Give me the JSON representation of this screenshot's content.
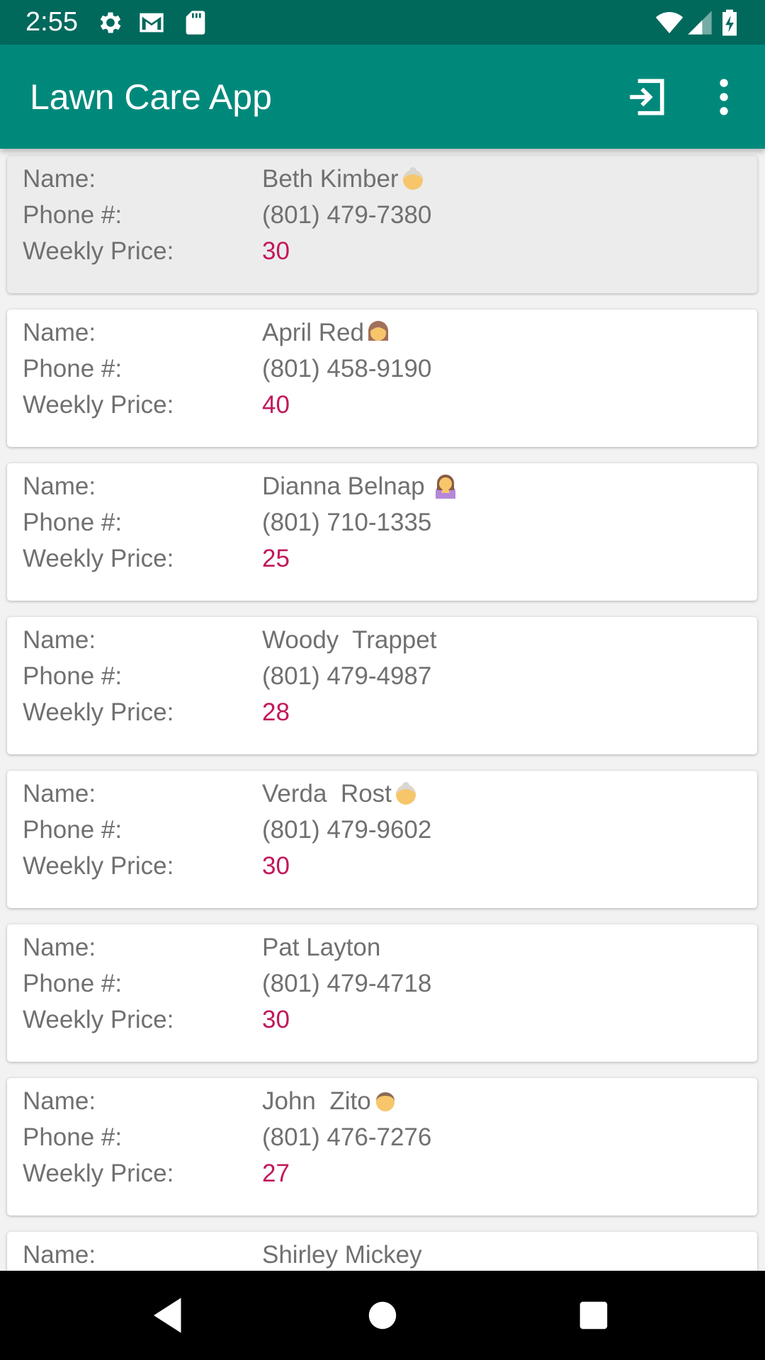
{
  "status_bar": {
    "time": "2:55",
    "left_icons": [
      "gear-icon",
      "gmail-icon",
      "sd-card-icon"
    ],
    "right_icons": [
      "wifi-icon",
      "cell-signal-icon",
      "battery-charging-icon"
    ]
  },
  "app_bar": {
    "title": "Lawn Care App",
    "actions": [
      "logout-icon",
      "more-vert-icon"
    ]
  },
  "labels": {
    "name": "Name:",
    "phone": "Phone #:",
    "price": "Weekly Price:"
  },
  "customers": [
    {
      "name": "Beth Kimber",
      "emoji": "older-woman",
      "phone": "(801) 479-7380",
      "price": "30",
      "selected": true
    },
    {
      "name": "April Red",
      "emoji": "woman",
      "phone": "(801) 458-9190",
      "price": "40"
    },
    {
      "name": "Dianna Belnap ",
      "emoji": "woman-facepalm",
      "phone": "(801) 710-1335",
      "price": "25"
    },
    {
      "name": "Woody  Trappet",
      "emoji": "",
      "phone": "(801) 479-4987",
      "price": "28"
    },
    {
      "name": "Verda  Rost",
      "emoji": "older-woman",
      "phone": "(801) 479-9602",
      "price": "30"
    },
    {
      "name": "Pat Layton",
      "emoji": "",
      "phone": "(801) 479-4718",
      "price": "30"
    },
    {
      "name": "John  Zito",
      "emoji": "man",
      "phone": "(801) 476-7276",
      "price": "27"
    },
    {
      "name": "Shirley Mickey",
      "emoji": "",
      "phone": "",
      "price": ""
    }
  ],
  "nav_bar": {
    "buttons": [
      "back-icon",
      "home-icon",
      "recents-icon"
    ]
  },
  "colors": {
    "status_bar": "#00695c",
    "app_bar": "#00897b",
    "price_text": "#c2185b",
    "label_text": "#707070"
  }
}
